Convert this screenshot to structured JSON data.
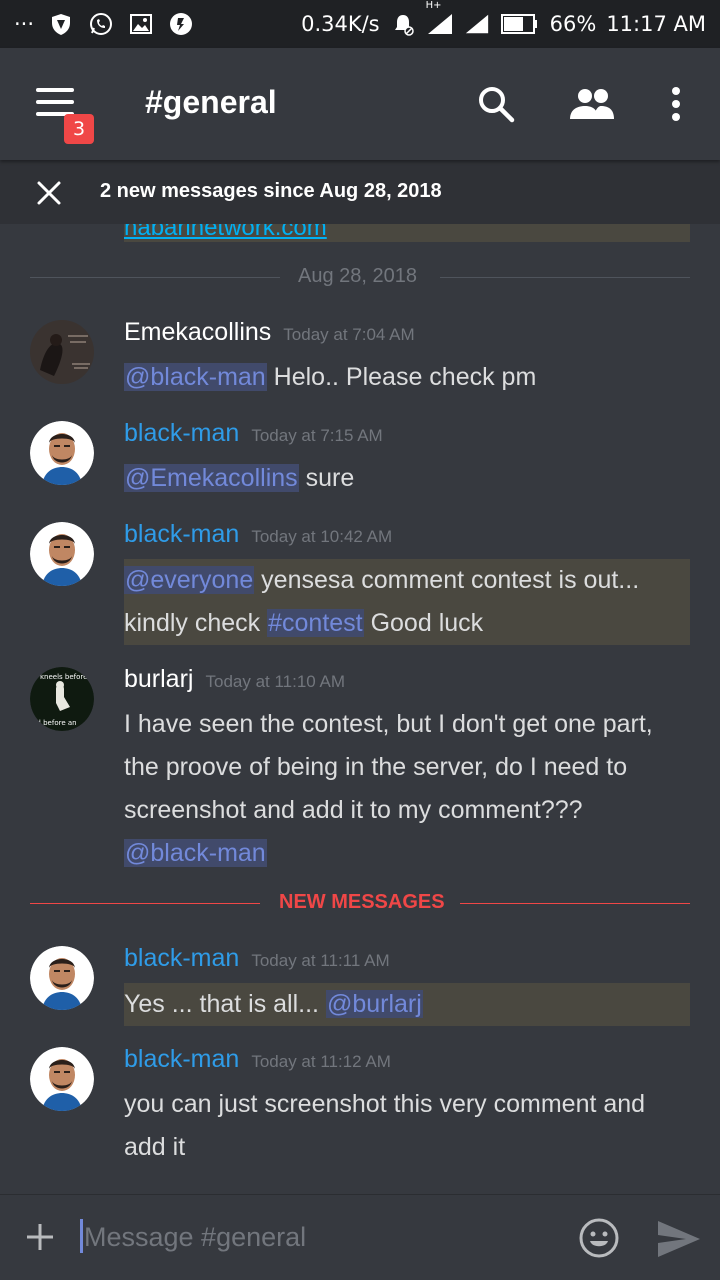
{
  "status_bar": {
    "dots": "···",
    "net_speed": "0.34K/s",
    "network_type": "H+",
    "battery": "66%",
    "time": "11:17 AM",
    "icons": [
      "vpn-shield-icon",
      "whatsapp-icon",
      "gallery-icon",
      "app-icon",
      "alarm-off-icon",
      "signal-icon",
      "signal-icon-2",
      "battery-icon"
    ]
  },
  "header": {
    "channel": "#general",
    "badge_count": "3",
    "icons": [
      "menu-icon",
      "search-icon",
      "members-icon",
      "more-vertical-icon"
    ]
  },
  "new_messages_bar": {
    "text": "2 new messages since Aug 28, 2018"
  },
  "previous_embed": {
    "link_text": "nabarinetwork.com"
  },
  "date_divider": "Aug 28, 2018",
  "new_messages_divider": "NEW MESSAGES",
  "messages": [
    {
      "author": "Emekacollins",
      "timestamp": "Today at 7:04 AM",
      "parts": [
        {
          "mention": "@black-man"
        },
        {
          "text": " Helo.. Please check pm"
        }
      ]
    },
    {
      "author": "black-man",
      "timestamp": "Today at 7:15 AM",
      "parts": [
        {
          "mention": "@Emekacollins"
        },
        {
          "text": " sure"
        }
      ]
    },
    {
      "author": "black-man",
      "timestamp": "Today at 10:42 AM",
      "mention_everyone": "@everyone",
      "text_1": " yensesa comment contest is out...",
      "text_2": "kindly check ",
      "channel_mention": "#contest",
      "text_3": " Good luck"
    },
    {
      "author": "burlarj",
      "timestamp": "Today at 11:10 AM",
      "line_1": "I have seen the contest,  but I don't get one part,",
      "line_2": "the proove of being in the server,  do I need to",
      "line_3": "screenshot and add it to my comment???",
      "mention": "@black-man",
      "avatar_text_top": "kneels before",
      "avatar_text_bottom": "nd before an"
    },
    {
      "author": "black-man",
      "timestamp": "Today at 11:11 AM",
      "text": "Yes ... that is all... ",
      "mention": "@burlarj"
    },
    {
      "author": "black-man",
      "timestamp": "Today at 11:12 AM",
      "line_1": "you can just screenshot this very comment and",
      "line_2": "add it"
    }
  ],
  "input": {
    "placeholder": "Message #general"
  },
  "colors": {
    "background": "#36393f",
    "username_blue": "#2f9ce8",
    "mention_text": "#7289da",
    "mention_bg": "#414a6b",
    "new_messages_red": "#f04747",
    "highlight_bg": "#4a4840"
  }
}
